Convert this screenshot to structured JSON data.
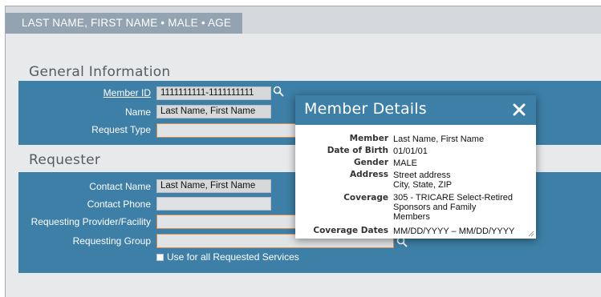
{
  "patient_header": {
    "text": "LAST NAME, FIRST NAME • MALE • AGE"
  },
  "general": {
    "title": "General Information",
    "member_id_label": "Member ID",
    "member_id_value": "1111111111-1111111111",
    "name_label": "Name",
    "name_value": "Last Name, First Name",
    "request_type_label": "Request Type",
    "request_type_value": ""
  },
  "requester": {
    "title": "Requester",
    "contact_name_label": "Contact Name",
    "contact_name_value": "Last Name, First Name",
    "contact_phone_label": "Contact Phone",
    "contact_phone_value": "",
    "provider_label": "Requesting Provider/Facility",
    "provider_value": "",
    "group_label": "Requesting Group",
    "group_value": "",
    "use_all_label": "Use for all Requested Services",
    "use_all_checked": false
  },
  "modal": {
    "title": "Member Details",
    "rows": [
      {
        "label": "Member",
        "value": "Last Name, First Name"
      },
      {
        "label": "Date of Birth",
        "value": "01/01/01"
      },
      {
        "label": "Gender",
        "value": "MALE"
      },
      {
        "label": "Address",
        "value": "Street address",
        "value2": "City, State, ZIP"
      },
      {
        "label": "Coverage",
        "value": "305 - TRICARE Select-Retired",
        "value2": "Sponsors and Family",
        "value3": "Members"
      },
      {
        "label": "Coverage Dates",
        "value": "MM/DD/YYYY – MM/DD/YYYY"
      }
    ]
  },
  "colors": {
    "panel": "#3d7fa6",
    "required_border": "#d98b4e",
    "patient_tab": "#93a3b1"
  },
  "icons": [
    "search-icon",
    "close-icon",
    "resize-grip-icon"
  ]
}
